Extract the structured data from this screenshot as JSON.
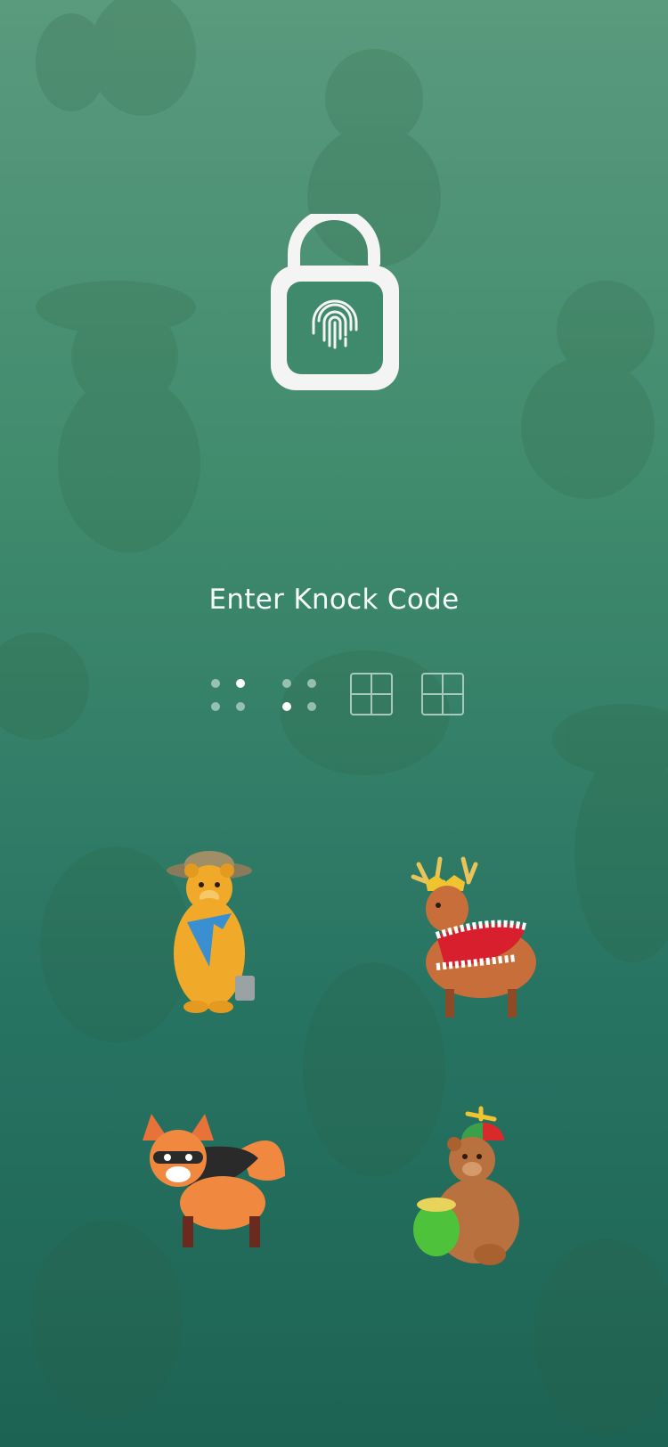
{
  "screen": {
    "title": "Enter Knock Code"
  },
  "lock": {
    "icon": "fingerprint-unlock-icon"
  },
  "code_progress": {
    "entered": 2,
    "total": 4
  },
  "tap_zones": [
    {
      "icon": "bear-with-fish-icon"
    },
    {
      "icon": "reindeer-king-icon"
    },
    {
      "icon": "raccoon-fox-icon"
    },
    {
      "icon": "bear-propeller-hat-icon"
    }
  ],
  "colors": {
    "bg_top": "#5a9a7d",
    "bg_bottom": "#1d6354",
    "text": "#f4fbf8"
  }
}
